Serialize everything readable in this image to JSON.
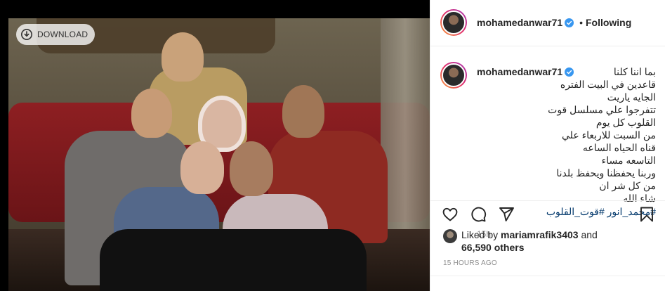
{
  "photo": {
    "download_label": "DOWNLOAD",
    "download_icon": "download-circle-icon"
  },
  "post": {
    "username": "mohamedanwar71",
    "verified": true,
    "follow_separator": "•",
    "follow_state": "Following",
    "caption_lines": "بما اننا كلنا\nقاعدين في البيت الفتره الجايه ياريت\nتتفرجوا علي مسلسل قوت القلوب كل يوم\nمن السبت للاربعاء علي قناه الحياه الساعه\nالتاسعه مساء\nوربنا يحفظنا ويحفظ بلدنا من كل شر ان\nشاء الله",
    "hashtags": "#محمد_انور #قوت_القلوب",
    "caption_age": "15h",
    "liked_by_prefix": "Liked by",
    "liked_by_user": "mariamrafik3403",
    "liked_by_and": "and",
    "others_count": "66,590 others",
    "posted_time": "15 HOURS AGO"
  },
  "icons": {
    "like": "heart-icon",
    "comment": "comment-icon",
    "share": "share-icon",
    "save": "bookmark-icon",
    "verified": "verified-badge-icon"
  },
  "colors": {
    "verified_blue": "#3897f0",
    "hashtag_blue": "#00376b",
    "muted_gray": "#8e8e8e"
  }
}
